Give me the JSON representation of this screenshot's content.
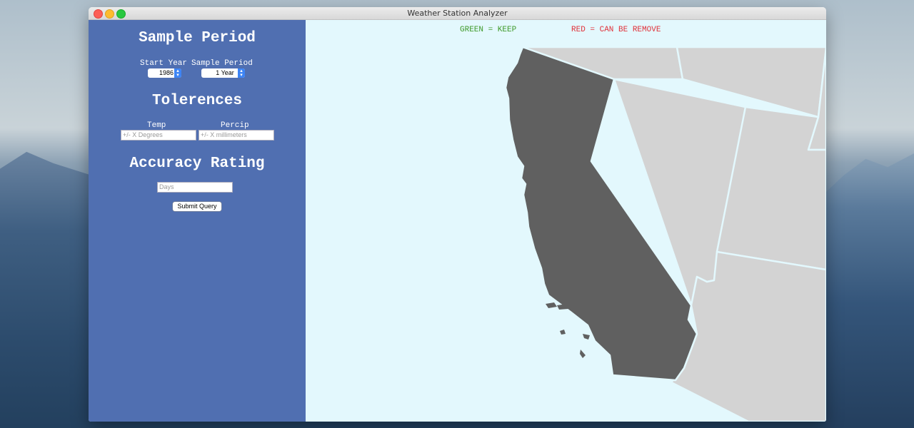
{
  "window": {
    "title": "Weather Station Analyzer"
  },
  "sidebar": {
    "sample_period": {
      "heading": "Sample Period",
      "start_year_label": "Start Year",
      "start_year_value": "1986",
      "period_label": "Sample Period",
      "period_value": "1 Year"
    },
    "tolerences": {
      "heading": "Tolerences",
      "temp_label": "Temp",
      "temp_placeholder": "+/- X Degrees",
      "percip_label": "Percip",
      "percip_placeholder": "+/- X millimeters"
    },
    "accuracy": {
      "heading": "Accuracy Rating",
      "days_placeholder": "Days"
    },
    "submit_label": "Submit Query"
  },
  "map": {
    "legend_keep": "GREEN = KEEP",
    "legend_remove": "RED = CAN BE REMOVE",
    "colors": {
      "selected_state": "#606060",
      "other_state": "#d3d3d3",
      "border": "#e3f8fd",
      "ocean": "#e3f8fd"
    }
  }
}
